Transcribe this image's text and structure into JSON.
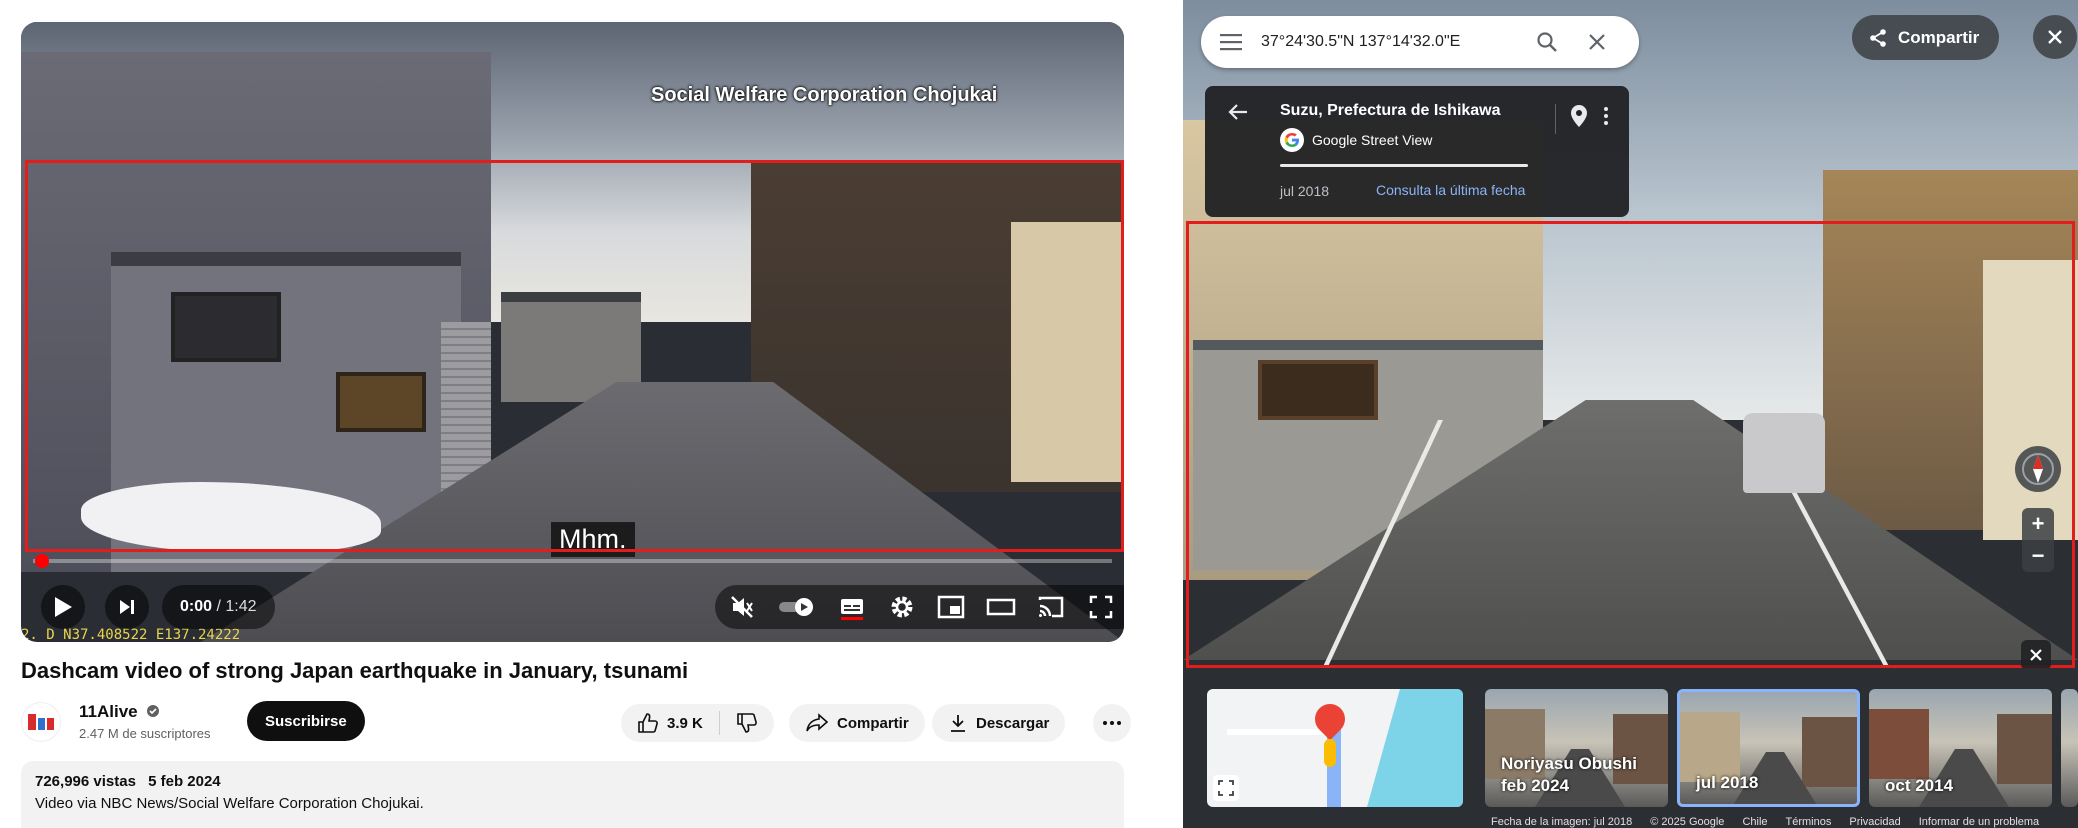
{
  "youtube": {
    "video": {
      "watermark": "Social Welfare Corporation Chojukai",
      "caption": "Mhm.",
      "time_current": "0:00",
      "time_total": "/ 1:42",
      "dashcam_readout": "2.  D          N37.408522  E137.24222",
      "progress": 0
    },
    "title": "Dashcam video of strong Japan earthquake in January, tsunami",
    "channel": {
      "name": "11Alive",
      "subscribers": "2.47 M de suscriptores",
      "subscribe_label": "Suscribirse"
    },
    "actions": {
      "likes": "3.9 K",
      "share_label": "Compartir",
      "download_label": "Descargar"
    },
    "description": {
      "views": "726,996 vistas",
      "date": "5 feb 2024",
      "text": "Video via NBC News/Social Welfare Corporation Chojukai."
    }
  },
  "streetview": {
    "search": {
      "value": "37°24'30.5\"N 137°14'32.0\"E"
    },
    "share_label": "Compartir",
    "card": {
      "location": "Suzu, Prefectura de Ishikawa",
      "source": "Google Street View",
      "date": "jul 2018",
      "link": "Consulta la última fecha"
    },
    "thumbnails": [
      {
        "line1": "Noriyasu Obushi",
        "line2": "feb 2024",
        "selected": false
      },
      {
        "line1": "",
        "line2": "jul 2018",
        "selected": true
      },
      {
        "line1": "",
        "line2": "oct 2014",
        "selected": false
      }
    ],
    "footer": {
      "image_date": "Fecha de la imagen: jul 2018",
      "copyright": "© 2025 Google",
      "country": "Chile",
      "terms": "Términos",
      "privacy": "Privacidad",
      "report": "Informar de un problema"
    },
    "zoom": {
      "in": "+",
      "out": "−"
    }
  },
  "colors": {
    "annotation_red": "#e31c1c",
    "youtube_red": "#ff0000",
    "maps_link": "#8ab4f8"
  }
}
